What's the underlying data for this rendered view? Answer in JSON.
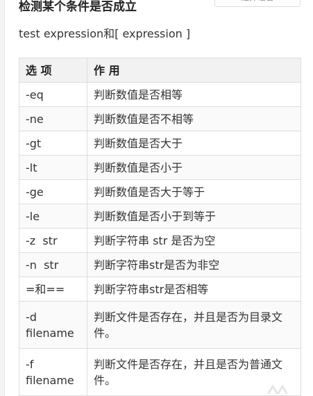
{
  "page": {
    "heading": "检测某个条件是否成立",
    "top_chip_label": "选择语言",
    "syntax_line": "test expression和[ expression ]"
  },
  "table": {
    "headers": [
      "选 项",
      "作 用"
    ],
    "rows": [
      {
        "option": "-eq",
        "effect": "判断数值是否相等"
      },
      {
        "option": "-ne",
        "effect": "判断数值是否不相等"
      },
      {
        "option": "-gt",
        "effect": "判断数值是否大于"
      },
      {
        "option": "-lt",
        "effect": "判断数值是否小于"
      },
      {
        "option": "-ge",
        "effect": "判断数值是否大于等于"
      },
      {
        "option": "-le",
        "effect": "判断数值是否小于到等于"
      },
      {
        "option": "-z  str",
        "effect": "判断字符串 str 是否为空"
      },
      {
        "option": "-n  str",
        "effect": "判断字符串str是否为非空"
      },
      {
        "option": "=和==",
        "effect": "判断字符串str是否相等"
      },
      {
        "option": "-d filename",
        "effect": "判断文件是否存在，并且是否为目录文件。"
      },
      {
        "option": "-f filename",
        "effect": "判断文件是否存在，并且是否为普通文件。"
      }
    ]
  },
  "colors": {
    "header_bg": "#f2f2f2",
    "border": "#dddddd",
    "text": "#333333"
  }
}
